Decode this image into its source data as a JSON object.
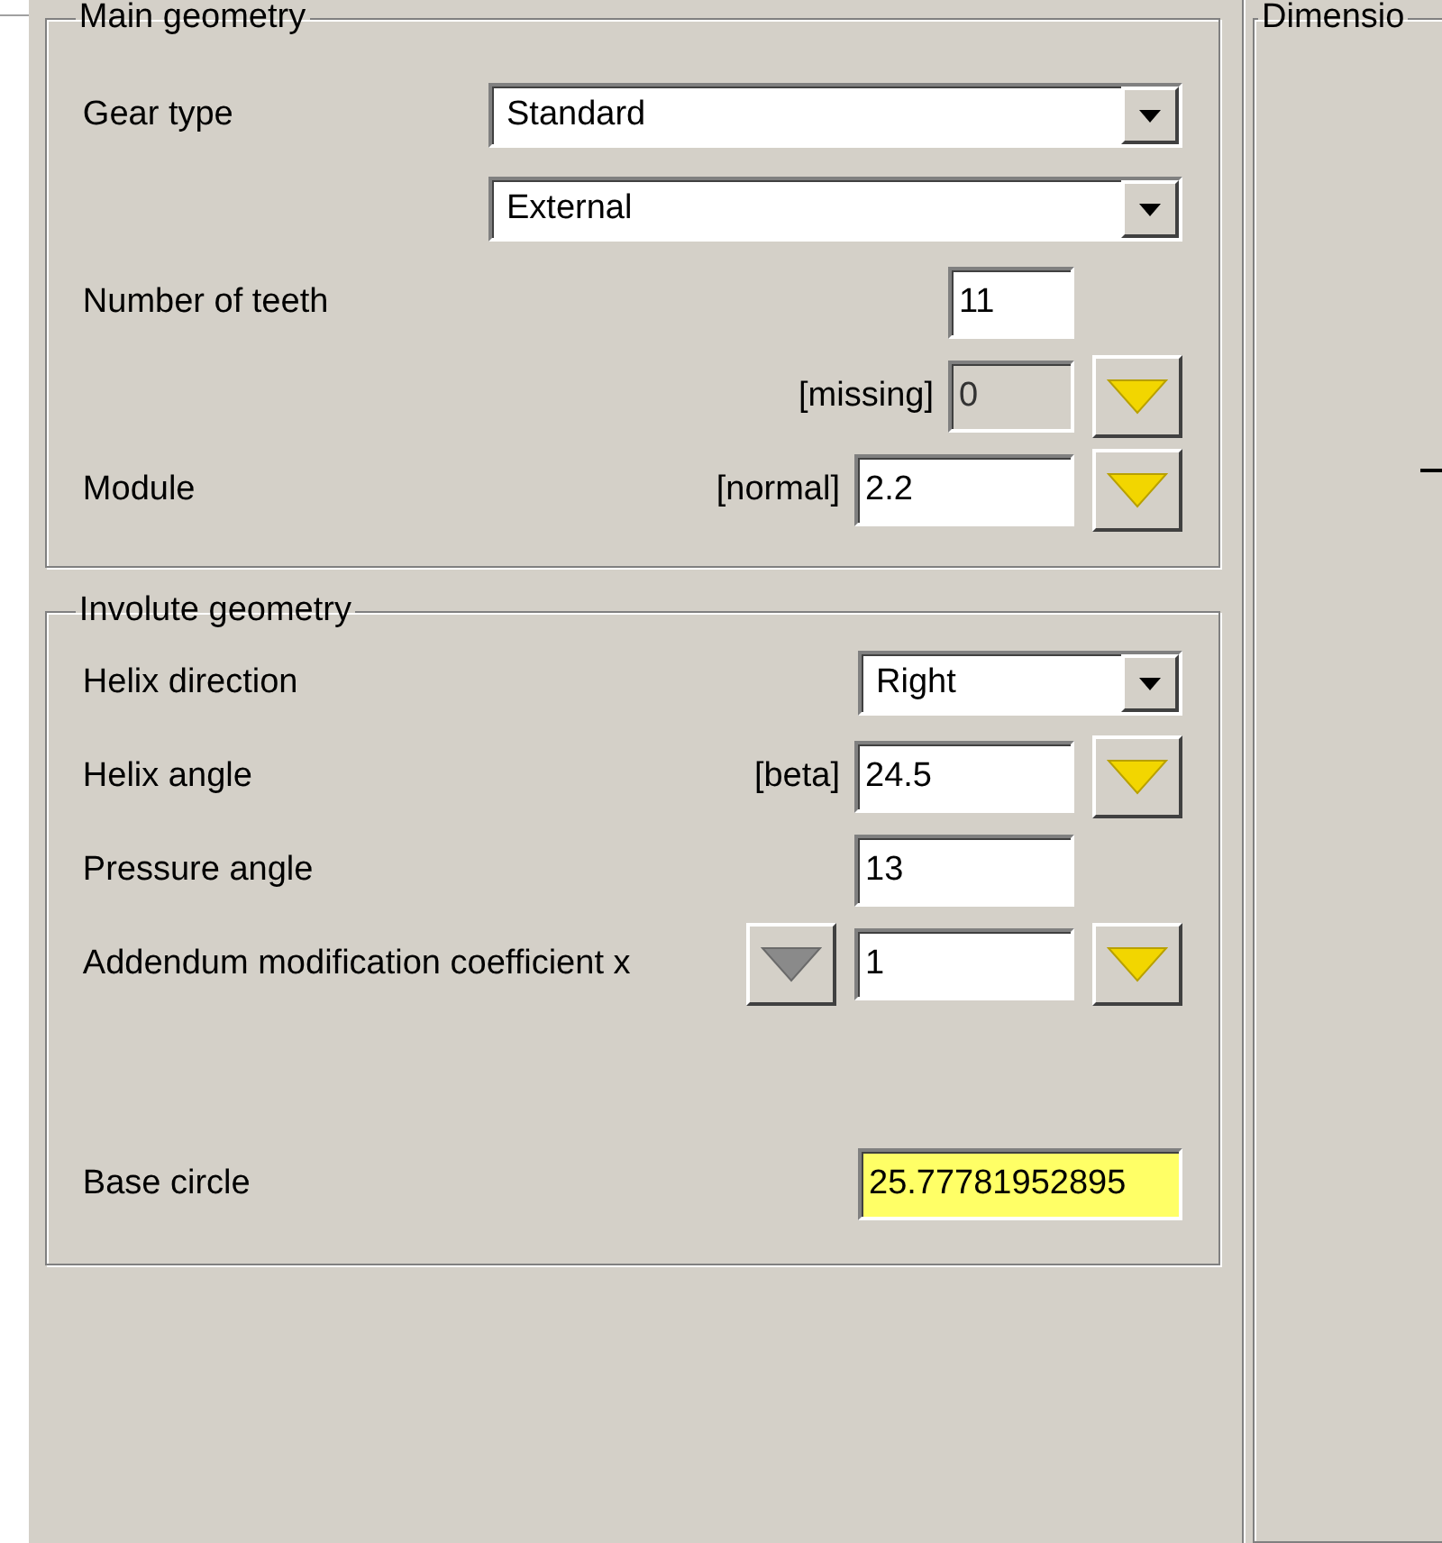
{
  "groups": [
    {
      "title": "Main geometry",
      "rows": [
        {
          "kind": "wide-select",
          "label": "Gear type",
          "value": "Standard"
        },
        {
          "kind": "wide-select",
          "value": "External"
        },
        {
          "kind": "short-input",
          "label": "Number of teeth",
          "value": "11",
          "disabled": false
        },
        {
          "kind": "short-input",
          "tag": "[missing]",
          "value": "0",
          "disabled": true,
          "picker": {
            "enabled": true
          }
        },
        {
          "kind": "input",
          "label": "Module",
          "tag": "[normal]",
          "value": "2.2",
          "disabled": false,
          "picker": {
            "enabled": true
          }
        }
      ]
    },
    {
      "title": "Involute geometry",
      "rows": [
        {
          "kind": "select",
          "label": "Helix direction",
          "value": "Right"
        },
        {
          "kind": "input",
          "label": "Helix angle",
          "tag": "[beta]",
          "value": "24.5",
          "disabled": false,
          "picker": {
            "enabled": true
          }
        },
        {
          "kind": "input",
          "label": "Pressure angle",
          "value": "13",
          "disabled": false
        },
        {
          "kind": "input",
          "label": "Addendum modification coefficient x",
          "value": "1",
          "disabled": false,
          "pre_picker": {
            "enabled": false
          },
          "picker": {
            "enabled": true
          }
        },
        {
          "kind": "result",
          "label": "Base circle",
          "value": "25.77781952895"
        }
      ]
    }
  ],
  "side_group": {
    "title": "Dimensio"
  }
}
